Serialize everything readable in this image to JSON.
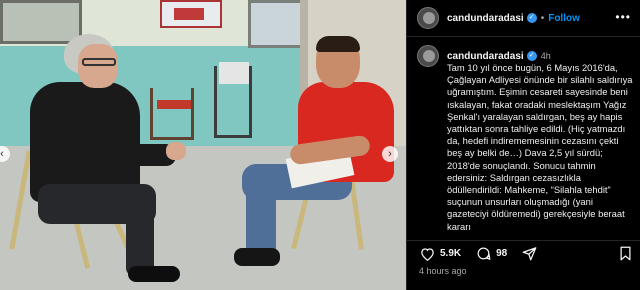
{
  "post": {
    "username": "candundaradasi",
    "verified_icon": "verified-badge-icon",
    "follow_label": "Follow",
    "more_icon": "more-options-icon"
  },
  "caption": {
    "username": "candundaradasi",
    "time": "4h",
    "text": "Tam 10 yıl önce bugün, 6 Mayıs 2016'da, Çağlayan Adliyesi önünde bir silahlı saldırıya uğramıştım. Eşimin cesareti sayesinde beni ıskalayan, fakat oradaki meslektaşım Yağız Şenkal'ı yaralayan saldırgan, beş ay hapis yattıktan sonra tahliye edildi. (Hiç yatmazdı da, hedefi indirememesinin cezasını çekti beş ay belki de…) Dava 2,5 yıl sürdü; 2018'de sonuçlandı. Sonucu tahmin edersiniz: Saldırgan cezasızlıkla ödüllendirildi: Mahkeme, “Silahla tehdit” suçunun unsurları oluşmadığı (yani gazeteciyi öldüremedi) gerekçesiyle beraat kararı"
  },
  "actions": {
    "likes": "5.9K",
    "comments": "98",
    "posted_ago": "4 hours ago"
  },
  "photo": {
    "prev_label": "‹",
    "next_label": "›"
  },
  "colors": {
    "background": "#000000",
    "link": "#0095f6",
    "verified": "#3897f0",
    "muted_text": "#a8a8a8"
  }
}
